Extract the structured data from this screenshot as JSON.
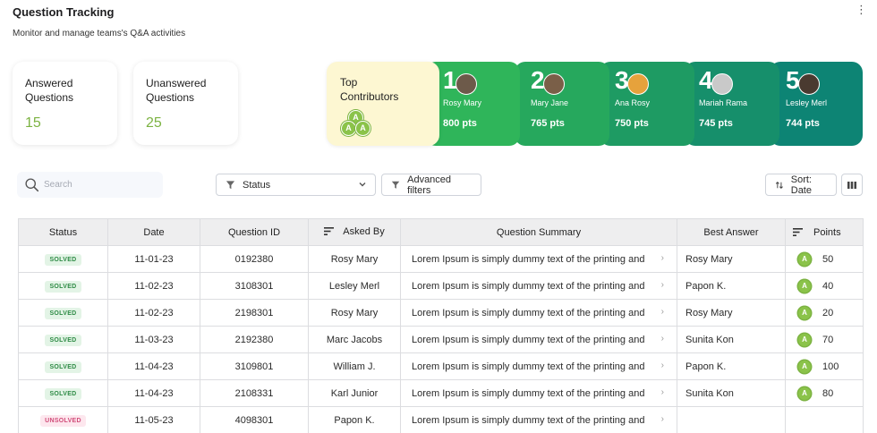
{
  "header": {
    "title": "Question Tracking",
    "subtitle": "Monitor and manage teams's Q&A activities",
    "menu_icon": "⋮"
  },
  "stats": {
    "answered": {
      "label": "Answered Questions",
      "value": "15"
    },
    "unanswered": {
      "label": "Unanswered Questions",
      "value": "25"
    }
  },
  "top_contributors": {
    "label": "Top Contributors",
    "badge_letter": "A",
    "items": [
      {
        "rank": "1",
        "name": "Rosy Mary",
        "points": "800 pts",
        "avatar_color": "#6d5a4a"
      },
      {
        "rank": "2",
        "name": "Mary Jane",
        "points": "765 pts",
        "avatar_color": "#7a5f48"
      },
      {
        "rank": "3",
        "name": "Ana Rosy",
        "points": "750 pts",
        "avatar_color": "#e6a23c"
      },
      {
        "rank": "4",
        "name": "Mariah Rama",
        "points": "745 pts",
        "avatar_color": "#c9c9c9"
      },
      {
        "rank": "5",
        "name": "Lesley Merl",
        "points": "744 pts",
        "avatar_color": "#4a3a30"
      }
    ]
  },
  "toolbar": {
    "search_placeholder": "Search",
    "status_label": "Status",
    "advanced_filters_label": "Advanced filters",
    "sort_label": "Sort: Date"
  },
  "table": {
    "columns": {
      "status": "Status",
      "date": "Date",
      "question_id": "Question ID",
      "asked_by": "Asked By",
      "summary": "Question Summary",
      "best_answer": "Best Answer",
      "points": "Points"
    },
    "rows": [
      {
        "status": "SOLVED",
        "date": "11-01-23",
        "id": "0192380",
        "asked_by": "Rosy Mary",
        "summary": "Lorem Ipsum is simply dummy text of the printing and",
        "best": "Rosy Mary",
        "points": "50"
      },
      {
        "status": "SOLVED",
        "date": "11-02-23",
        "id": "3108301",
        "asked_by": "Lesley Merl",
        "summary": "Lorem Ipsum is simply dummy text of the printing and",
        "best": "Papon K.",
        "points": "40"
      },
      {
        "status": "SOLVED",
        "date": "11-02-23",
        "id": "2198301",
        "asked_by": "Rosy Mary",
        "summary": "Lorem Ipsum is simply dummy text of the printing and",
        "best": "Rosy Mary",
        "points": "20"
      },
      {
        "status": "SOLVED",
        "date": "11-03-23",
        "id": "2192380",
        "asked_by": "Marc Jacobs",
        "summary": "Lorem Ipsum is simply dummy text of the printing and",
        "best": "Sunita Kon",
        "points": "70"
      },
      {
        "status": "SOLVED",
        "date": "11-04-23",
        "id": "3109801",
        "asked_by": "William J.",
        "summary": "Lorem Ipsum is simply dummy text of the printing and",
        "best": "Papon K.",
        "points": "100"
      },
      {
        "status": "SOLVED",
        "date": "11-04-23",
        "id": "2108331",
        "asked_by": "Karl Junior",
        "summary": "Lorem Ipsum is simply dummy text of the printing and",
        "best": "Sunita Kon",
        "points": "80"
      },
      {
        "status": "UNSOLVED",
        "date": "11-05-23",
        "id": "4098301",
        "asked_by": "Papon K.",
        "summary": "Lorem Ipsum is simply dummy text of the printing and",
        "best": "",
        "points": ""
      }
    ]
  }
}
